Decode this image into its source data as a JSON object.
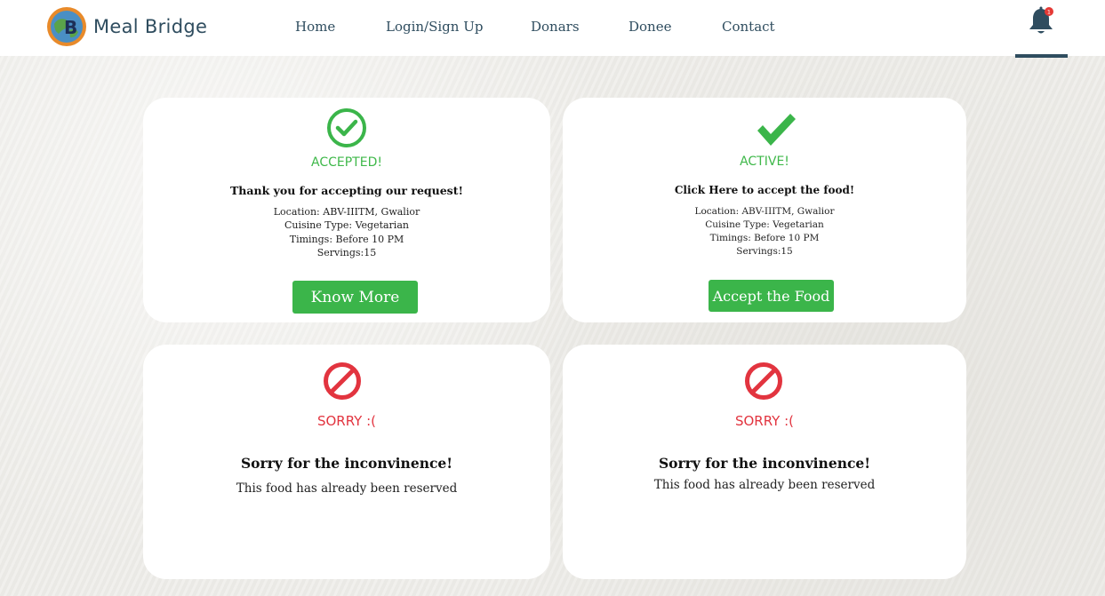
{
  "nav": {
    "brand": "Meal Bridge",
    "links": [
      "Home",
      "Login/Sign Up",
      "Donars",
      "Donee",
      "Contact"
    ],
    "notification_count": "1",
    "colors": {
      "text": "#2f4d5f",
      "badge": "#e53935"
    }
  },
  "cards": [
    {
      "icon": "check-circle-icon",
      "status": "ACCEPTED!",
      "headline": "Thank you for accepting our request!",
      "details": [
        "Location: ABV-IIITM, Gwalior",
        "Cuisine Type: Vegetarian",
        "Timings: Before 10 PM",
        "Servings:15"
      ],
      "button": "Know More"
    },
    {
      "icon": "check-mark-icon",
      "status": "ACTIVE!",
      "headline": "Click Here to accept the food!",
      "details": [
        "Location: ABV-IIITM, Gwalior",
        "Cuisine Type: Vegetarian",
        "Timings: Before 10 PM",
        "Servings:15"
      ],
      "button": "Accept the Food"
    },
    {
      "icon": "prohibited-icon",
      "status": "SORRY :(",
      "headline": "Sorry for the inconvinence!",
      "text": "This food has already been reserved"
    },
    {
      "icon": "prohibited-icon",
      "status": "SORRY :(",
      "headline": "Sorry for the inconvinence!",
      "text": "This food has already been reserved"
    }
  ],
  "colors": {
    "green": "#3bb54a",
    "red": "#e2343f",
    "card_bg": "#ffffff"
  }
}
